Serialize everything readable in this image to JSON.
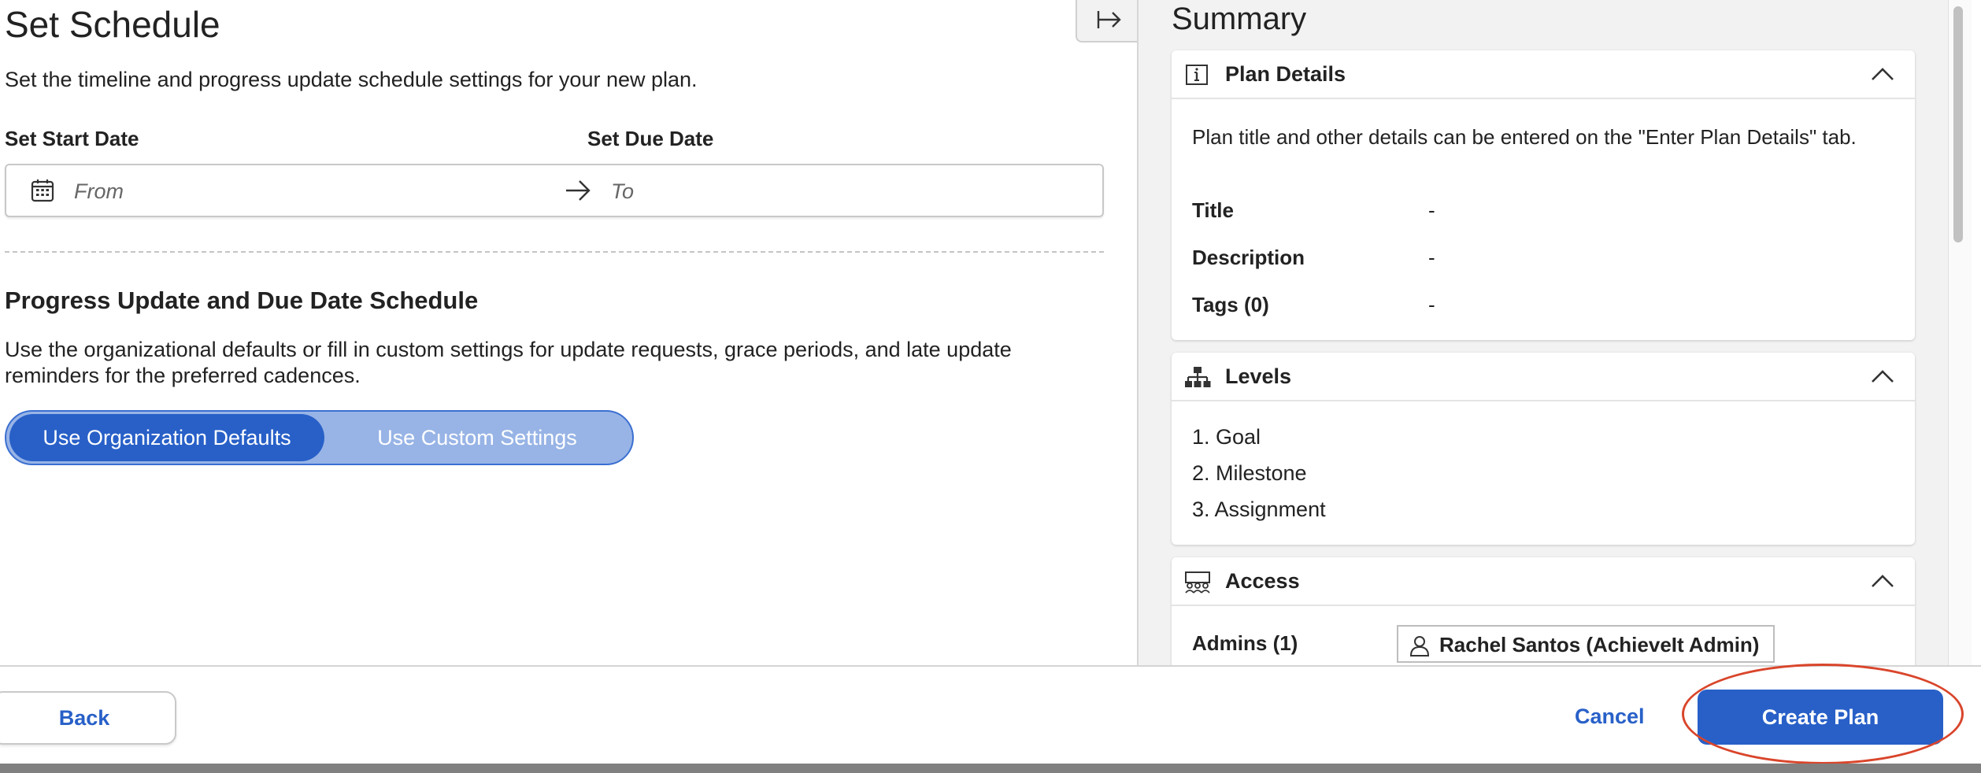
{
  "main": {
    "title": "Set Schedule",
    "subtitle": "Set the timeline and progress update schedule settings for your new plan.",
    "start_label": "Set Start Date",
    "due_label": "Set Due Date",
    "from_placeholder": "From",
    "to_placeholder": "To",
    "schedule_title": "Progress Update and Due Date Schedule",
    "schedule_desc": "Use the organizational defaults or fill in custom settings for update requests, grace periods, and late update reminders for the preferred cadences.",
    "toggle_active": "Use Organization Defaults",
    "toggle_inactive": "Use Custom Settings"
  },
  "summary": {
    "title": "Summary",
    "plan_details": {
      "title": "Plan Details",
      "note": "Plan title and other details can be entered on the \"Enter Plan Details\" tab.",
      "rows": [
        {
          "key": "Title",
          "value": "-"
        },
        {
          "key": "Description",
          "value": "-"
        },
        {
          "key": "Tags (0)",
          "value": "-"
        }
      ]
    },
    "levels": {
      "title": "Levels",
      "items": [
        "1. Goal",
        "2. Milestone",
        "3. Assignment"
      ]
    },
    "access": {
      "title": "Access",
      "admins_label": "Admins (1)",
      "admin_name": "Rachel Santos (AchieveIt Admin)"
    }
  },
  "footer": {
    "back": "Back",
    "cancel": "Cancel",
    "create": "Create Plan"
  },
  "colors": {
    "accent": "#2860c8",
    "toggle_bg": "#98b4e6",
    "highlight": "#d9452b",
    "panel_bg": "#f2f2f2"
  }
}
